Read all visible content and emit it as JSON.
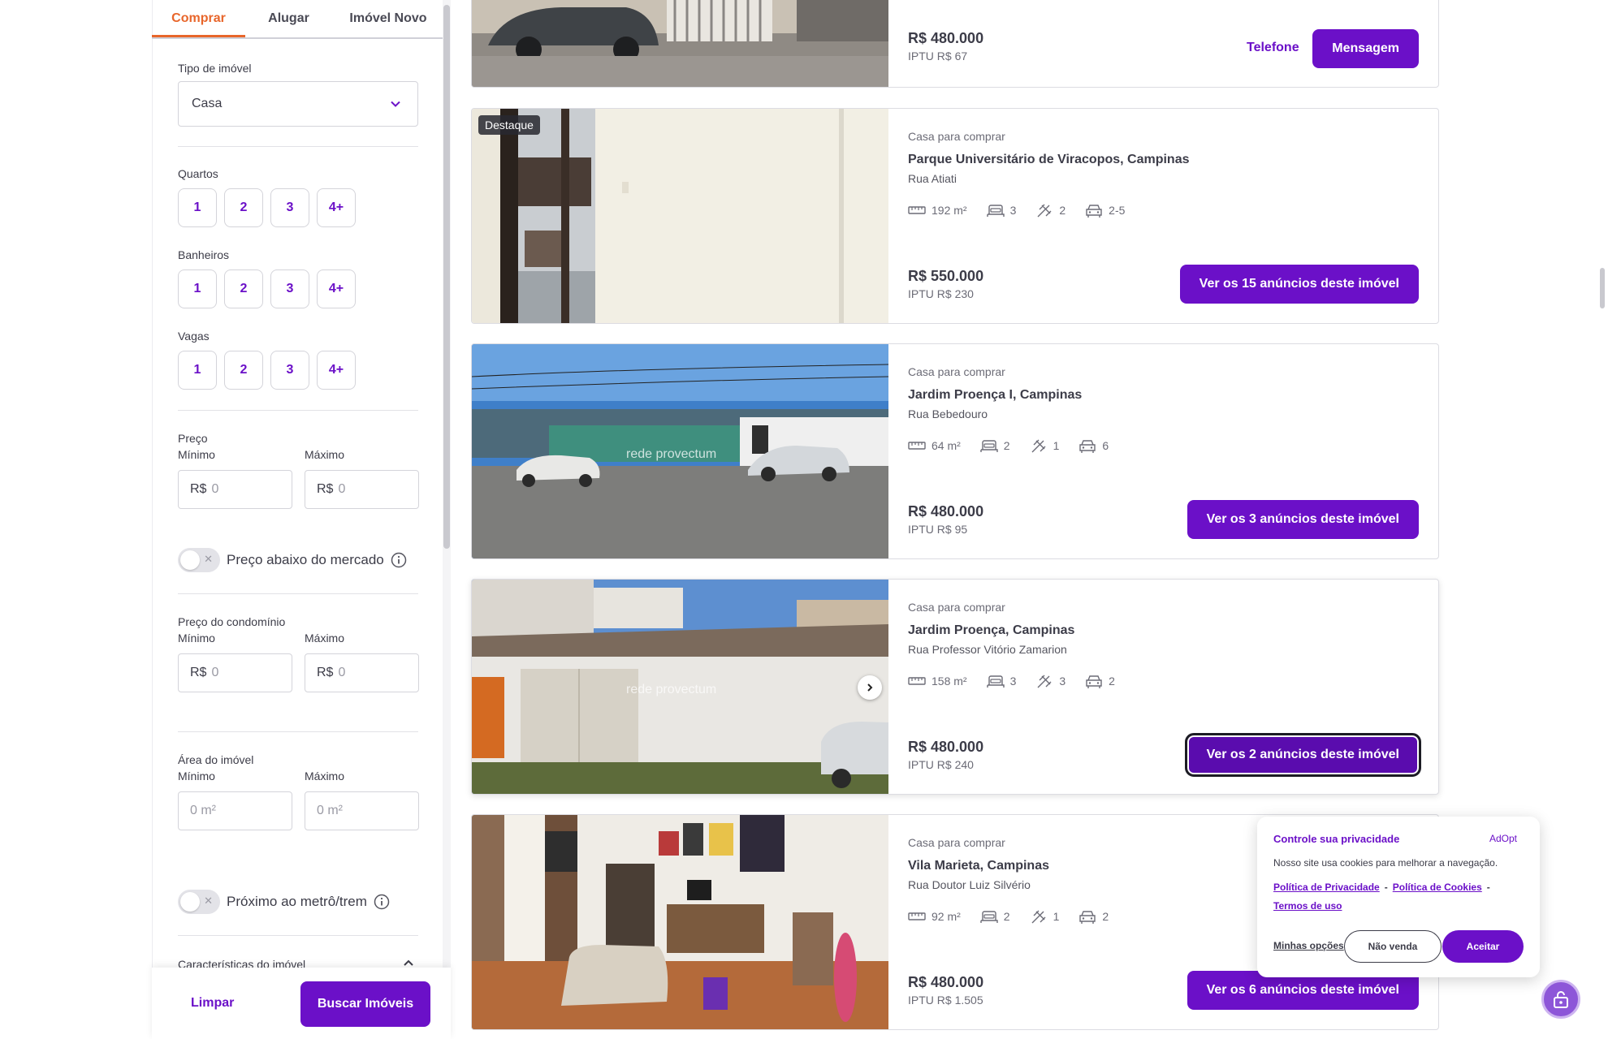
{
  "sidebar": {
    "tabs": [
      {
        "label": "Comprar",
        "active": true
      },
      {
        "label": "Alugar",
        "active": false
      },
      {
        "label": "Imóvel Novo",
        "active": false
      }
    ],
    "property_type": {
      "label": "Tipo de imóvel",
      "value": "Casa"
    },
    "rooms": {
      "label": "Quartos",
      "options": [
        "1",
        "2",
        "3",
        "4+"
      ]
    },
    "bathrooms": {
      "label": "Banheiros",
      "options": [
        "1",
        "2",
        "3",
        "4+"
      ]
    },
    "parking": {
      "label": "Vagas",
      "options": [
        "1",
        "2",
        "3",
        "4+"
      ]
    },
    "price": {
      "label": "Preço",
      "min_label": "Mínimo",
      "max_label": "Máximo",
      "currency": "R$",
      "min_placeholder": "0",
      "max_placeholder": "0"
    },
    "below_market": {
      "label": "Preço abaixo do mercado",
      "enabled": false
    },
    "condo_price": {
      "label": "Preço do condomínio",
      "min_label": "Mínimo",
      "max_label": "Máximo",
      "currency": "R$",
      "min_placeholder": "0",
      "max_placeholder": "0"
    },
    "area": {
      "label": "Área do imóvel",
      "min_label": "Mínimo",
      "max_label": "Máximo",
      "min_placeholder": "0 m²",
      "max_placeholder": "0 m²"
    },
    "near_metro": {
      "label": "Próximo ao metrô/trem",
      "enabled": false
    },
    "features": {
      "label": "Características do imóvel"
    },
    "clear_label": "Limpar",
    "search_label": "Buscar Imóveis"
  },
  "listings": [
    {
      "price": "R$ 480.000",
      "iptu": "IPTU R$ 67",
      "phone_label": "Telefone",
      "message_label": "Mensagem"
    },
    {
      "badge": "Destaque",
      "kind": "Casa para comprar",
      "title": "Parque Universitário de Viracopos, Campinas",
      "street": "Rua Atiati",
      "area": "192 m²",
      "bedrooms": "3",
      "bathrooms": "2",
      "parking": "2-5",
      "price": "R$ 550.000",
      "iptu": "IPTU R$ 230",
      "cta": "Ver os 15 anúncios deste imóvel"
    },
    {
      "kind": "Casa para comprar",
      "title": "Jardim Proença I, Campinas",
      "street": "Rua Bebedouro",
      "area": "64 m²",
      "bedrooms": "2",
      "bathrooms": "1",
      "parking": "6",
      "price": "R$ 480.000",
      "iptu": "IPTU R$ 95",
      "cta": "Ver os 3 anúncios deste imóvel",
      "watermark": "rede provectum"
    },
    {
      "kind": "Casa para comprar",
      "title": "Jardim Proença, Campinas",
      "street": "Rua Professor Vitório Zamarion",
      "area": "158 m²",
      "bedrooms": "3",
      "bathrooms": "3",
      "parking": "2",
      "price": "R$ 480.000",
      "iptu": "IPTU R$ 240",
      "cta": "Ver os 2 anúncios deste imóvel",
      "watermark": "rede provectum"
    },
    {
      "kind": "Casa para comprar",
      "title": "Vila Marieta, Campinas",
      "street": "Rua Doutor Luiz Silvério",
      "area": "92 m²",
      "bedrooms": "2",
      "bathrooms": "1",
      "parking": "2",
      "price": "R$ 480.000",
      "iptu": "IPTU R$ 1.505",
      "cta": "Ver os 6 anúncios deste imóvel"
    }
  ],
  "cookie_banner": {
    "title": "Controle sua privacidade",
    "brand": "AdOpt",
    "description": "Nosso site usa cookies para melhorar a navegação.",
    "privacy_policy": "Política de Privacidade",
    "cookie_policy": "Política de Cookies",
    "terms": "Termos de uso",
    "my_options": "Minhas opções",
    "do_not_sell": "Não venda",
    "accept": "Aceitar"
  },
  "colors": {
    "accent": "#6b10c8",
    "active_tab": "#e8662b"
  },
  "icons": [
    "chevron-down-icon",
    "info-icon",
    "ruler-icon",
    "bed-icon",
    "shower-icon",
    "car-icon",
    "chevron-right-icon",
    "lock-icon"
  ]
}
